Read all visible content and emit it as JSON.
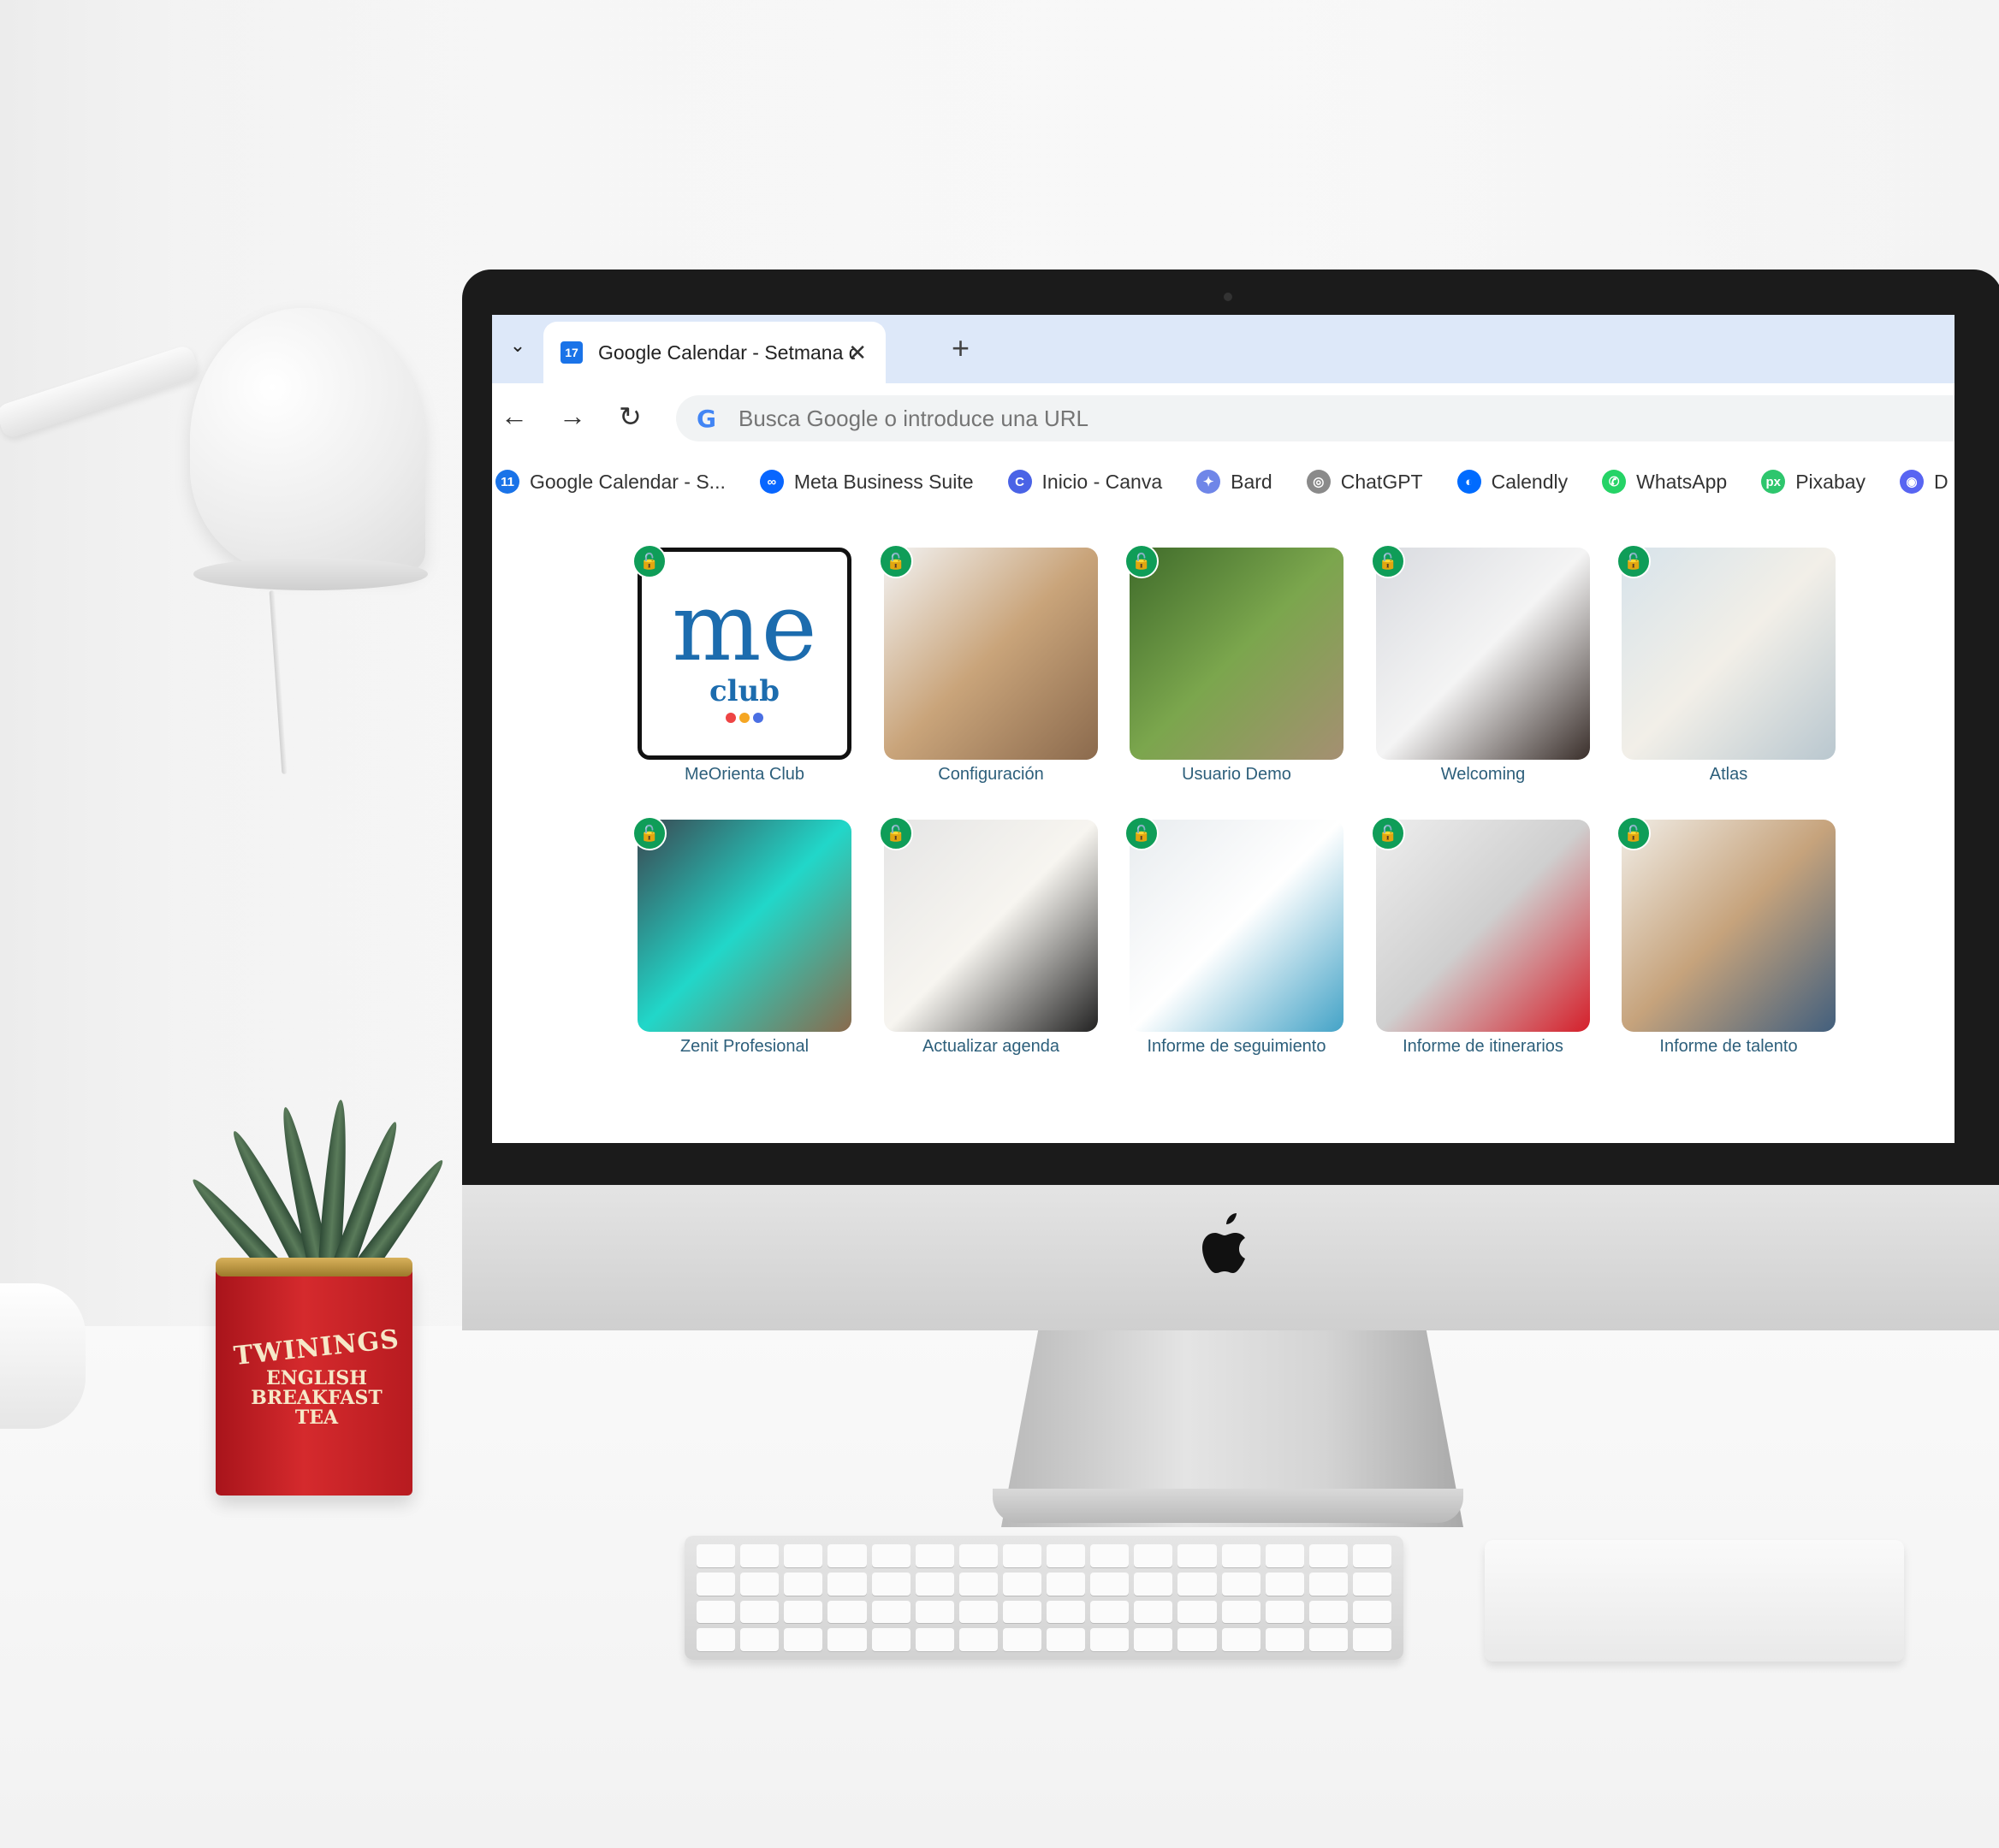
{
  "browser": {
    "tab": {
      "title": "Google Calendar - Setmana del"
    },
    "new_tab_symbol": "+",
    "address": {
      "placeholder": "Busca Google o introduce una URL"
    },
    "bookmarks": [
      {
        "label": "Google Calendar - S...",
        "icon": "calendar-icon",
        "color": "#1a73e8",
        "glyph": "11"
      },
      {
        "label": "Meta Business Suite",
        "icon": "meta-icon",
        "color": "#0866ff",
        "glyph": "∞"
      },
      {
        "label": "Inicio - Canva",
        "icon": "canva-icon",
        "color": "#4a63e6",
        "glyph": "C"
      },
      {
        "label": "Bard",
        "icon": "bard-sparkle-icon",
        "color": "#6f86e8",
        "glyph": "✦"
      },
      {
        "label": "ChatGPT",
        "icon": "chatgpt-icon",
        "color": "#8a8a8a",
        "glyph": "◎"
      },
      {
        "label": "Calendly",
        "icon": "calendly-icon",
        "color": "#006bff",
        "glyph": "◐"
      },
      {
        "label": "WhatsApp",
        "icon": "whatsapp-icon",
        "color": "#25d366",
        "glyph": "✆"
      },
      {
        "label": "Pixabay",
        "icon": "pixabay-icon",
        "color": "#2ec66d",
        "glyph": "px"
      },
      {
        "label": "D",
        "icon": "discord-icon",
        "color": "#5865f2",
        "glyph": "◉"
      }
    ]
  },
  "shortcuts": [
    {
      "label": "MeOrienta Club",
      "style": "logo"
    },
    {
      "label": "Configuración",
      "colors": [
        "#f3f3f3",
        "#c9a47a",
        "#8b6a4d"
      ]
    },
    {
      "label": "Usuario Demo",
      "colors": [
        "#3f6b2a",
        "#7ba64d",
        "#a58f72"
      ]
    },
    {
      "label": "Welcoming",
      "colors": [
        "#d9dbe0",
        "#f4f4f4",
        "#3a2f2b"
      ]
    },
    {
      "label": "Atlas",
      "colors": [
        "#d7e3ea",
        "#f2efe8",
        "#b9c7cf"
      ]
    },
    {
      "label": "Zenit Profesional",
      "colors": [
        "#3b4650",
        "#21d7c9",
        "#8a6a4c"
      ]
    },
    {
      "label": "Actualizar agenda",
      "colors": [
        "#e5e5e5",
        "#f7f5f0",
        "#222222"
      ]
    },
    {
      "label": "Informe de seguimiento",
      "colors": [
        "#e8ecef",
        "#ffffff",
        "#44a3c7"
      ]
    },
    {
      "label": "Informe de itinerarios",
      "colors": [
        "#eeeeee",
        "#cfcfcf",
        "#d51f2a"
      ]
    },
    {
      "label": "Informe de talento",
      "colors": [
        "#f1ede6",
        "#c6a37c",
        "#425f7d"
      ]
    }
  ],
  "logo": {
    "me": "me",
    "club": "club"
  },
  "tea_tin": {
    "brand": "TWININGS",
    "line1": "ENGLISH",
    "line2": "BREAKFAST",
    "line3": "TEA"
  }
}
